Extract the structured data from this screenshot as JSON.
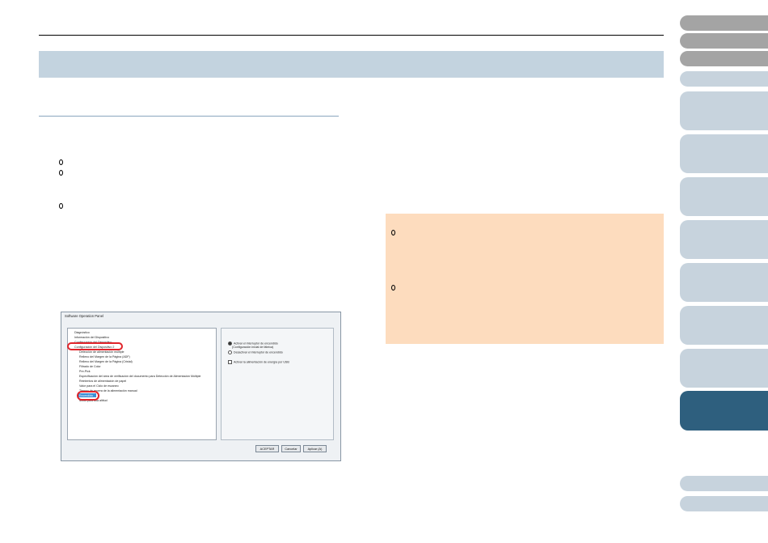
{
  "screenshot": {
    "window_title": "Software Operation Panel",
    "tree": [
      "Diagnóstico",
      "Información del Dispositivo",
      "Configuración del Dispositivo",
      "Configuración del Dispositivo 2",
      "Detección de alimentación múltiple",
      "Relleno del Margen de la Página (ADF)",
      "Relleno del Margen de la Página (Cristal)",
      "Filtrado de Color",
      "Pre-Pick",
      "Especificación del área de verificación del documento para Detección de Alimentación Múltiple",
      "Reintentos de alimentación de papel",
      "Valor para el Ciclo de escaneo",
      "Tiempo de espera de la alimentación manual",
      "Encendido",
      "Modo para alta altitud"
    ],
    "options": {
      "radio1": "Activar el interruptor de encendido",
      "radio1_note": "(Configuración inicial de fábrica)",
      "radio2": "Desactivar el interruptor de encendido",
      "checkbox": "Activar la alimentación de energía por USB"
    },
    "buttons": {
      "ok": "ACEPTAR",
      "cancel": "Cancelar",
      "apply": "Aplicar (A)"
    }
  },
  "colors": {
    "banner": "#c3d3df",
    "hint_box": "#fddcbe",
    "tab_gray": "#a4a4a4",
    "tab_light": "#c7d3dd",
    "tab_active": "#2e5f7e",
    "highlight": "#e0242a"
  }
}
